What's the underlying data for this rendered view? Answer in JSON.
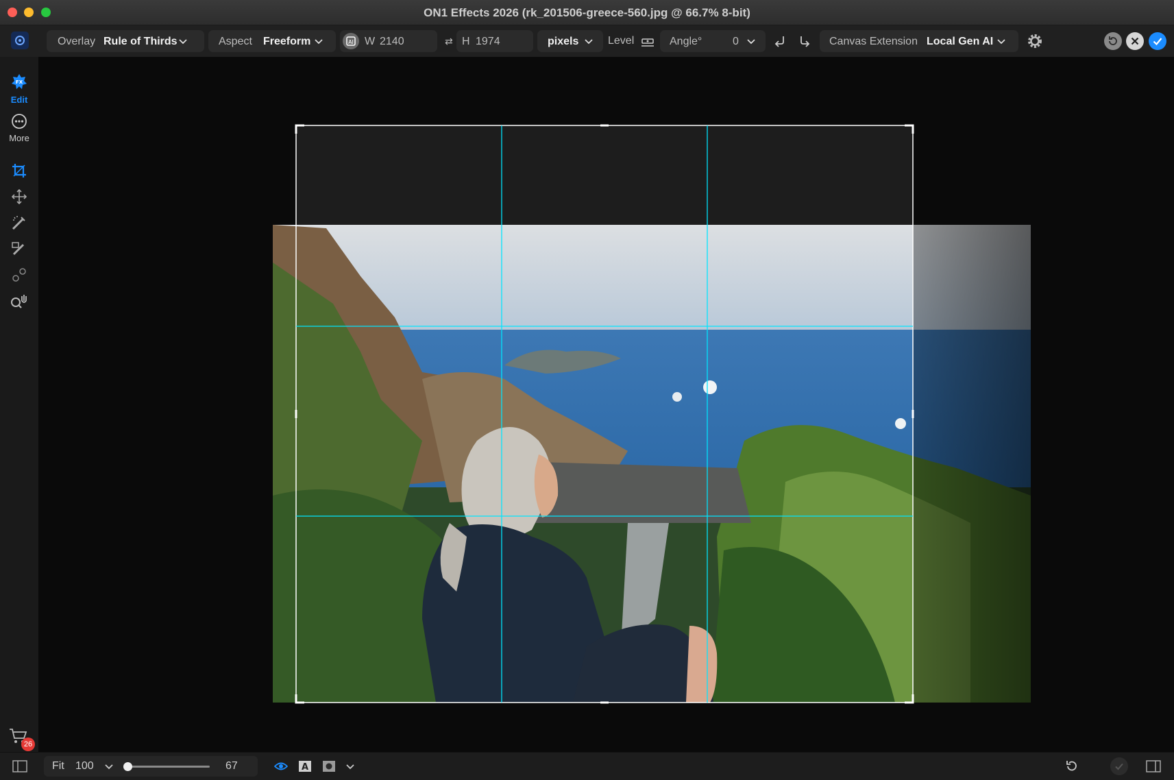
{
  "window": {
    "title": "ON1 Effects 2026 (rk_201506-greece-560.jpg @ 66.7% 8-bit)"
  },
  "toolbar": {
    "overlay_label": "Overlay",
    "overlay_value": "Rule of Thirds",
    "aspect_label": "Aspect",
    "aspect_value": "Freeform",
    "width_label": "W",
    "width_value": "2140",
    "swap_symbol": "⇄",
    "height_label": "H",
    "height_value": "1974",
    "units_value": "pixels",
    "level_label": "Level",
    "angle_label": "Angle°",
    "angle_value": "0",
    "canvas_extension_label": "Canvas Extension",
    "canvas_extension_value": "Local Gen AI"
  },
  "sidebar": {
    "items": [
      {
        "label": "Edit",
        "icon": "edit-fx-icon",
        "active": true
      },
      {
        "label": "More",
        "icon": "more-icon",
        "active": false
      }
    ],
    "tools": [
      "crop-icon",
      "move-icon",
      "retouch-brush-icon",
      "masking-brush-icon",
      "perfect-brush-icon",
      "zoom-hand-icon"
    ],
    "cart_badge": "26"
  },
  "statusbar": {
    "fit_label": "Fit",
    "zoom_preset": "100",
    "zoom_value": "67",
    "zoom_fraction": 0.03
  },
  "colors": {
    "accent": "#1b8cff",
    "grid_line": "#00e5ff",
    "badge": "#e53935"
  }
}
